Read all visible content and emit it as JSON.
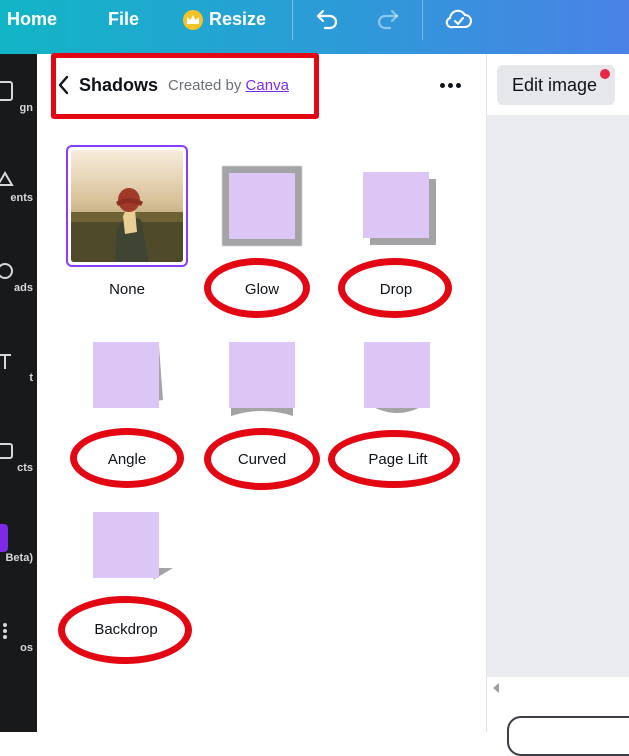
{
  "topbar": {
    "home": "Home",
    "file": "File",
    "resize": "Resize"
  },
  "left_rail": [
    {
      "label": "gn",
      "icon": "design-icon"
    },
    {
      "label": "ents",
      "icon": "elements-icon"
    },
    {
      "label": "ads",
      "icon": "uploads-icon"
    },
    {
      "label": "t",
      "icon": "text-icon"
    },
    {
      "label": "cts",
      "icon": "projects-icon"
    },
    {
      "label": "Beta)",
      "icon": "beta-app-icon"
    },
    {
      "label": "os",
      "icon": "apps-icon"
    }
  ],
  "panel": {
    "title": "Shadows",
    "created_by": "Created by",
    "creator": "Canva"
  },
  "edit_image": "Edit image",
  "effects": [
    {
      "label": "None"
    },
    {
      "label": "Glow"
    },
    {
      "label": "Drop"
    },
    {
      "label": "Angle"
    },
    {
      "label": "Curved"
    },
    {
      "label": "Page Lift"
    },
    {
      "label": "Backdrop"
    }
  ],
  "colors": {
    "accent": "#8b3dff",
    "swatch": "#dcc6f5",
    "annotation_red": "#e30613",
    "shadow_gray": "#a4a4a6"
  }
}
